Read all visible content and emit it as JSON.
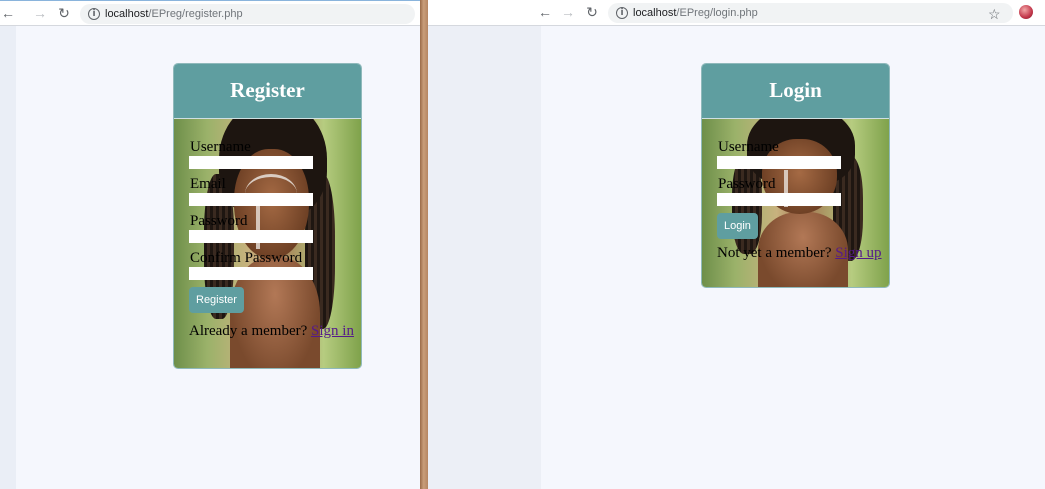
{
  "left_window": {
    "toolbar": {
      "back_icon": "back-arrow-icon",
      "forward_icon": "forward-arrow-icon",
      "reload_icon": "reload-icon",
      "info_icon": "info-icon",
      "url_host": "localhost",
      "url_path": "/EPreg/register.php"
    },
    "card": {
      "title": "Register",
      "fields": [
        {
          "label": "Username",
          "value": ""
        },
        {
          "label": "Email",
          "value": ""
        },
        {
          "label": "Password",
          "value": ""
        },
        {
          "label": "Confirm Password",
          "value": ""
        }
      ],
      "button_label": "Register",
      "footer_text": "Already a member?",
      "footer_link": "Sign in"
    }
  },
  "right_window": {
    "toolbar": {
      "back_icon": "back-arrow-icon",
      "forward_icon": "forward-arrow-icon",
      "reload_icon": "reload-icon",
      "info_icon": "info-icon",
      "url_host": "localhost",
      "url_path": "/EPreg/login.php",
      "star_icon": "star-icon",
      "profile_icon": "profile-icon"
    },
    "card": {
      "title": "Login",
      "fields": [
        {
          "label": "Username",
          "value": ""
        },
        {
          "label": "Password",
          "value": ""
        }
      ],
      "button_label": "Login",
      "footer_text": "Not yet a member?",
      "footer_link": "Sign up"
    }
  },
  "colors": {
    "accent": "#5f9ea0",
    "link": "#551a8b",
    "page_background": "#f5f7fd"
  }
}
